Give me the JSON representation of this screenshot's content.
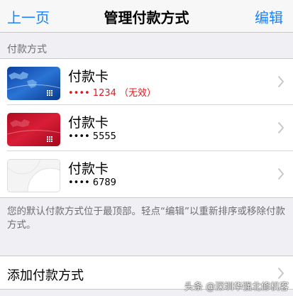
{
  "nav": {
    "back_label": "上一页",
    "title": "管理付款方式",
    "edit_label": "编辑"
  },
  "section": {
    "header": "付款方式"
  },
  "cards": [
    {
      "title": "付款卡",
      "number": "•••• 1234 （无效）",
      "status": "invalid",
      "color": "#1e5bbf"
    },
    {
      "title": "付款卡",
      "number": "•••• 5555",
      "status": "valid",
      "color": "#c8102e"
    },
    {
      "title": "付款卡",
      "number": "•••• 6789",
      "status": "valid",
      "color": "#eeeeee"
    }
  ],
  "footer_note": "您的默认付款方式位于最顶部。轻点“编辑”以重新排序或移除付款方式。",
  "add": {
    "label": "添加付款方式"
  },
  "watermark": "头条 @深圳华强北修机客",
  "colors": {
    "accent": "#1a82fb",
    "invalid": "#e0191f",
    "background": "#efeff4"
  }
}
